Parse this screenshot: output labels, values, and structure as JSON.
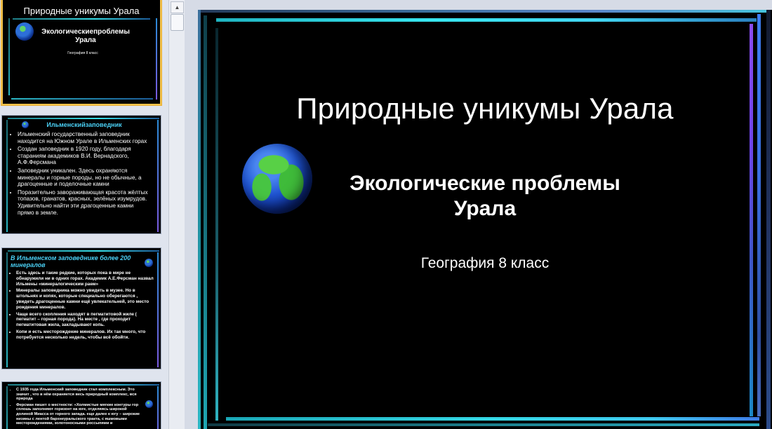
{
  "thumbnails": [
    {
      "title": "Природные уникумы Урала",
      "subtitle": "Экологическиепроблемы Урала",
      "caption": "География 8 класс"
    },
    {
      "title": "Ильменскийзаповедник",
      "bullets": [
        "Ильменский государственный заповедник находится на Южном Урале в Ильменских горах",
        "Создан заповедник в 1920 году, благодаря стараниям академиков В.И. Вернадского, А.Ф.Ферсмана",
        "Заповедник уникален. Здесь охраняются минералы и горные породы, но не обычные, а драгоценные и поделочные камни",
        "Поразительно завораживающая красота жёлтых топазов, гранатов, красных, зелёных изумрудов. Удивительно найти эти драгоценные камни прямо в земле."
      ]
    },
    {
      "title": "В Ильменском заповеднике более 200 минералов",
      "bullets": [
        "Есть здесь и такие редкие, которых пока в мире не обнаружили ни в одних горах. Академик А.Е.Ферсман назвал Ильмены «минералогическим раем»",
        "Минералы заповедника можно увидеть в музее. Но в штольнях и копях, которые специально оберегаются , увидеть драгоценные камни ещё увлекательней, это место рождения минералов.",
        "Чаще всего скопления находят в пегматитовой жиле ( пегматит – горная порода). На месте , где проходит пегматитовая жила, закладывают копь.",
        "Копи и есть месторождение минералов. Их так много, что потребуется несколько недель, чтобы всё обойти."
      ]
    },
    {
      "bullets": [
        "С 1935 года Ильменский заповедник стал комплексным. Это значит , что в нём охраняется весь природный комплекс, вся природа",
        "Ферсман пишет о местности: «Холмистые мягкие контуры гор сплошь заполняют горизонт на юге, отделяясь широкой долиной Миасса от горного запада. еще далее к югу – широкие низины с лентой бархнеуральского тракта, с яшмовыми месторождениями, золотоносными россыпями и"
      ]
    }
  ],
  "slide": {
    "title": "Природные уникумы Урала",
    "subtitle": "Экологические проблемы Урала",
    "caption": "География 8 класс"
  },
  "colors": {
    "frame_cyan": "#38e6f0",
    "frame_purple": "#7a4ee8",
    "frame_blue": "#3a7ef0",
    "selected_border": "#f2c24b",
    "bullet_title": "#4ad0f5"
  },
  "icons": {
    "globe": "globe-icon",
    "scroll_up": "scroll-up-arrow-icon"
  }
}
